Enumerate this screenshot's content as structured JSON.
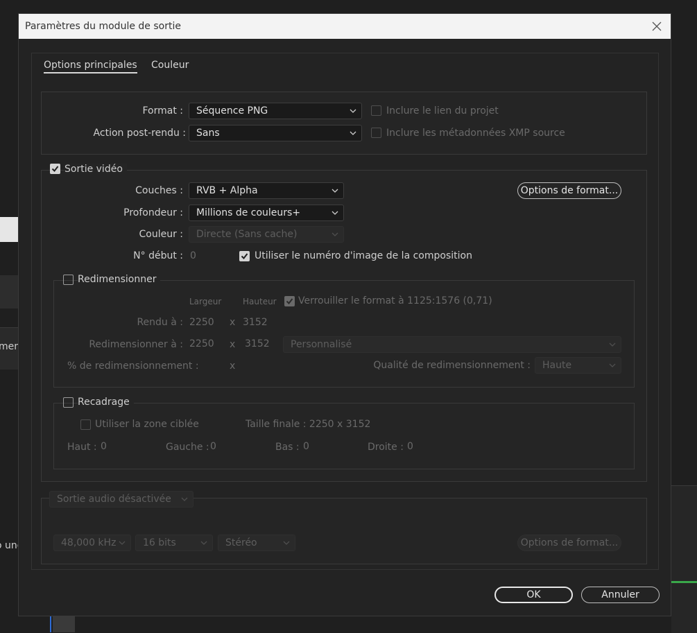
{
  "background": {
    "left_fragment_1": "men",
    "left_fragment_2": "o une"
  },
  "dialog": {
    "title": "Paramètres du module de sortie",
    "tabs": [
      {
        "label": "Options principales",
        "active": true
      },
      {
        "label": "Couleur",
        "active": false
      }
    ],
    "format_section": {
      "format_label": "Format :",
      "format_value": "Séquence PNG",
      "post_render_label": "Action post-rendu :",
      "post_render_value": "Sans",
      "include_project_link": {
        "label": "Inclure le lien du projet",
        "checked": false,
        "enabled": false
      },
      "include_xmp": {
        "label": "Inclure les métadonnées XMP source",
        "checked": false,
        "enabled": false
      }
    },
    "video_output": {
      "checkbox_label": "Sortie vidéo",
      "checked": true,
      "channels_label": "Couches :",
      "channels_value": "RVB + Alpha",
      "depth_label": "Profondeur :",
      "depth_value": "Millions de couleurs+",
      "color_label": "Couleur :",
      "color_value": "Directe (Sans cache)",
      "start_label": "N° début :",
      "start_value": "0",
      "use_comp_frame": {
        "label": "Utiliser le numéro d'image de la composition",
        "checked": true
      },
      "format_options_button": "Options de format..."
    },
    "resize": {
      "checkbox_label": "Redimensionner",
      "checked": false,
      "col_width": "Largeur",
      "col_height": "Hauteur",
      "lock_aspect": {
        "label": "Verrouiller le format à 1125:1576 (0,71)",
        "checked": true
      },
      "rendered_label": "Rendu à :",
      "rendered_w": "2250",
      "rendered_h": "3152",
      "x_sep": "x",
      "resize_to_label": "Redimensionner à :",
      "resize_to_w": "2250",
      "resize_to_h": "3152",
      "preset_value": "Personnalisé",
      "percent_label": "% de redimensionnement :",
      "quality_label": "Qualité de redimensionnement :",
      "quality_value": "Haute"
    },
    "crop": {
      "checkbox_label": "Recadrage",
      "checked": false,
      "use_roi": {
        "label": "Utiliser la zone ciblée",
        "checked": false
      },
      "final_size": "Taille finale : 2250 x 3152",
      "top_label": "Haut :",
      "top_value": "0",
      "left_label": "Gauche :",
      "left_value": "0",
      "bottom_label": "Bas :",
      "bottom_value": "0",
      "right_label": "Droite :",
      "right_value": "0"
    },
    "audio": {
      "output_value": "Sortie audio désactivée",
      "sample_rate": "48,000 kHz",
      "bit_depth": "16 bits",
      "channels": "Stéréo",
      "format_options_button": "Options de format..."
    },
    "ok_button": "OK",
    "cancel_button": "Annuler"
  }
}
